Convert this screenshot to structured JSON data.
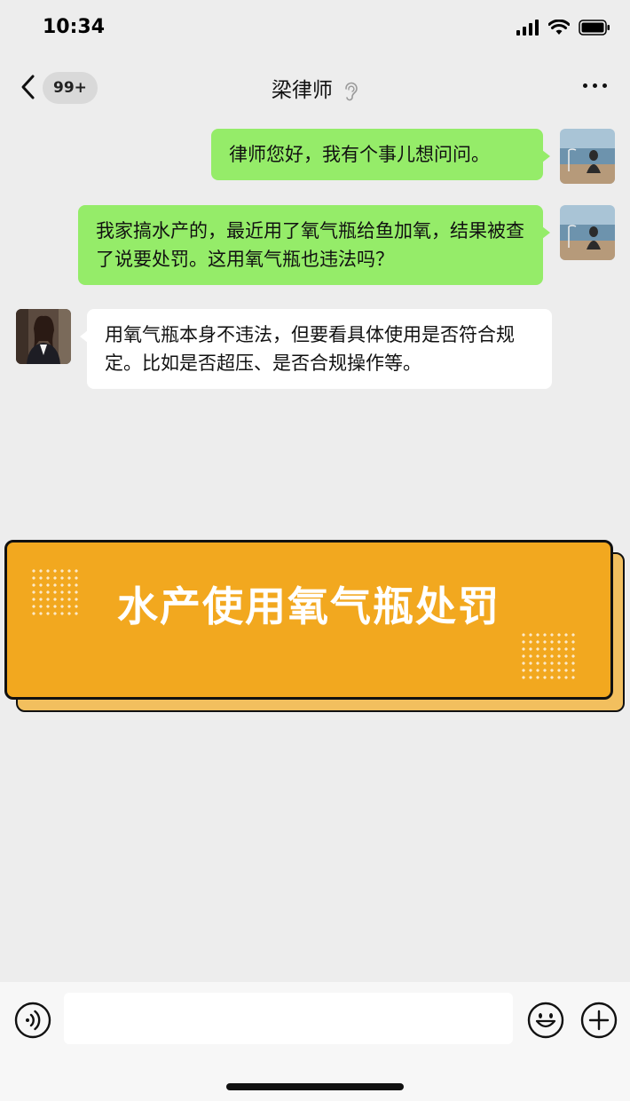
{
  "status_bar": {
    "time": "10:34"
  },
  "nav": {
    "badge": "99+",
    "title": "梁律师"
  },
  "messages": [
    {
      "side": "out",
      "text": "律师您好，我有个事儿想问问。"
    },
    {
      "side": "out",
      "text": "我家搞水产的，最近用了氧气瓶给鱼加氧，结果被查了说要处罚。这用氧气瓶也违法吗？"
    },
    {
      "side": "in",
      "text": "用氧气瓶本身不违法，但要看具体使用是否符合规定。比如是否超压、是否合规操作等。"
    }
  ],
  "banner": {
    "title": "水产使用氧气瓶处罚"
  },
  "input": {
    "value": ""
  },
  "colors": {
    "background": "#ededed",
    "outgoing_bubble": "#95ec69",
    "incoming_bubble": "#ffffff",
    "banner": "#f2a81f"
  },
  "icons": [
    "signal-icon",
    "wifi-icon",
    "battery-icon",
    "back-icon",
    "ear-icon",
    "more-icon",
    "voice-icon",
    "emoji-icon",
    "plus-icon"
  ]
}
